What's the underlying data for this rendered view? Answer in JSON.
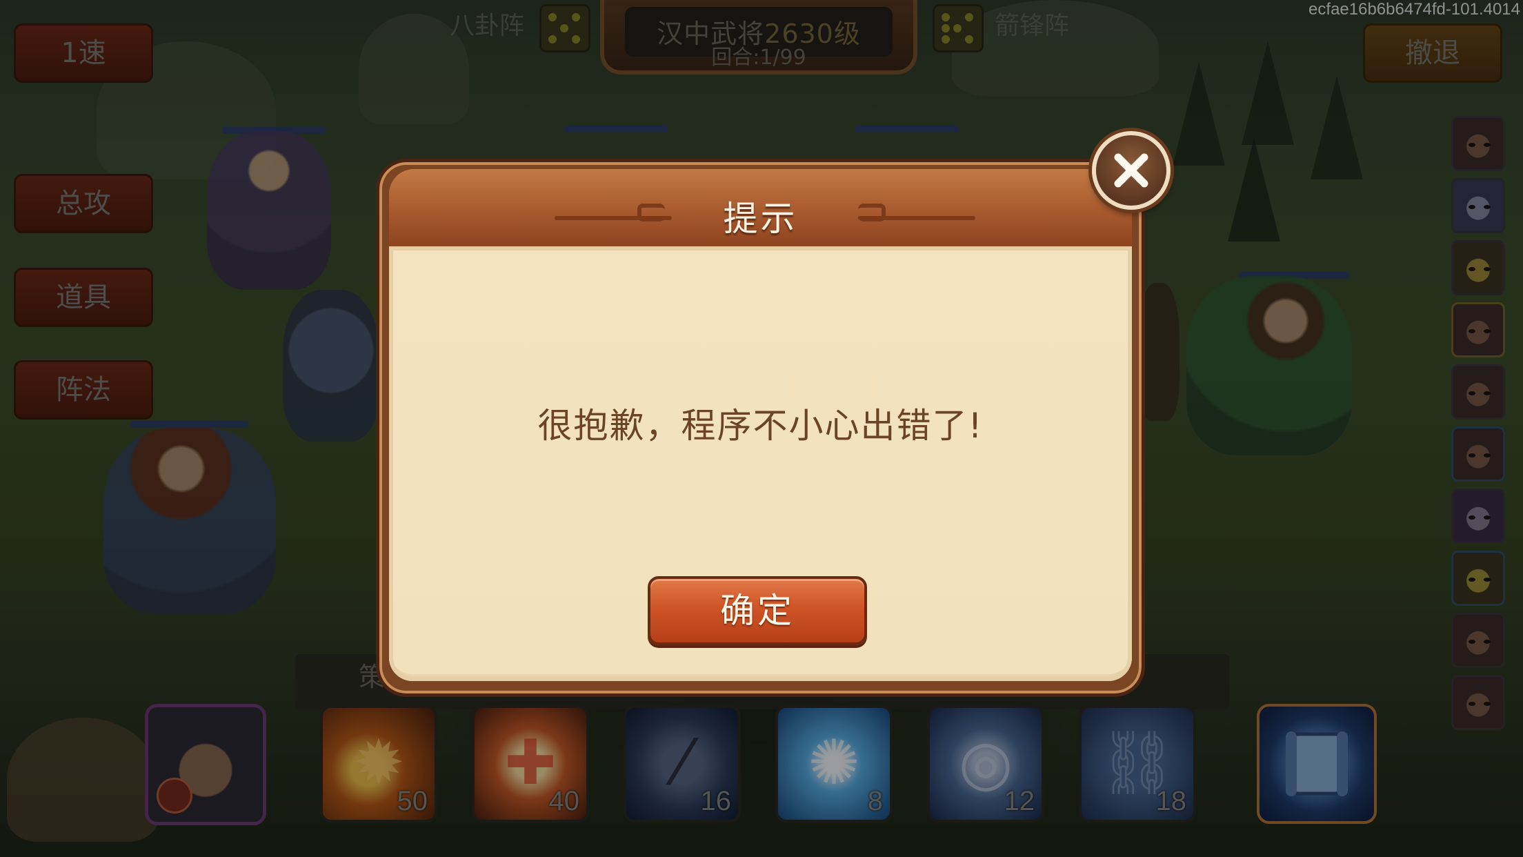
{
  "top_bar": {
    "left_formation": "八卦阵",
    "right_formation": "箭锋阵",
    "enemy_name": "汉中武将",
    "enemy_level": "2630级",
    "round": "回合:1/99",
    "version": "ecfae16b6b6474fd-101.4014"
  },
  "left_buttons": [
    "1速",
    "总攻",
    "道具",
    "阵法"
  ],
  "retreat_label": "撤退",
  "dialog": {
    "title": "提示",
    "message": "很抱歉，程序不小心出错了!",
    "confirm_label": "确定"
  },
  "skill_bar": {
    "label": "策",
    "skills": [
      {
        "icon": "fire-icon",
        "cost": "50"
      },
      {
        "icon": "heal-cross-icon",
        "cost": "40"
      },
      {
        "icon": "scroll-tube-icon",
        "cost": "16"
      },
      {
        "icon": "burst-icon",
        "cost": "8"
      },
      {
        "icon": "vortex-icon",
        "cost": "12"
      },
      {
        "icon": "chain-icon",
        "cost": "18"
      }
    ]
  },
  "colors": {
    "dialog_frame": "#7b4422",
    "dialog_body": "#f4e3c0",
    "confirm_button": "#cf5426",
    "title_text": "#fbf2e4"
  }
}
